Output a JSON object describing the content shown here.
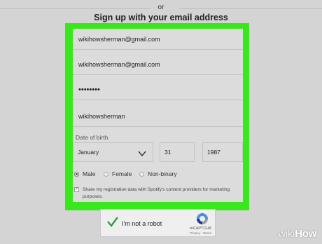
{
  "divider": {
    "or_text": "or"
  },
  "heading": "Sign up with your email address",
  "colors": {
    "highlight": "#39e81b",
    "form_bg": "#dcdcdc",
    "page_bg": "#d4d4d4"
  },
  "form": {
    "email": "wikihowsherman@gmail.com",
    "confirm_email": "wikihowsherman@gmail.com",
    "password": "••••••••",
    "display_name": "wikihowsherman",
    "dob_label": "Date of birth",
    "dob": {
      "month": "January",
      "day": "31",
      "year": "1987"
    },
    "gender": {
      "selected": "Male",
      "options": [
        "Male",
        "Female",
        "Non-binary"
      ]
    },
    "consent_checked": true,
    "consent_text": "Share my registration data with Spotify's content providers for marketing purposes."
  },
  "captcha": {
    "label": "I'm not a robot",
    "brand": "reCAPTCHA",
    "links": "Privacy - Terms",
    "checked": true
  },
  "watermark": {
    "prefix": "wiki",
    "suffix": "How"
  }
}
